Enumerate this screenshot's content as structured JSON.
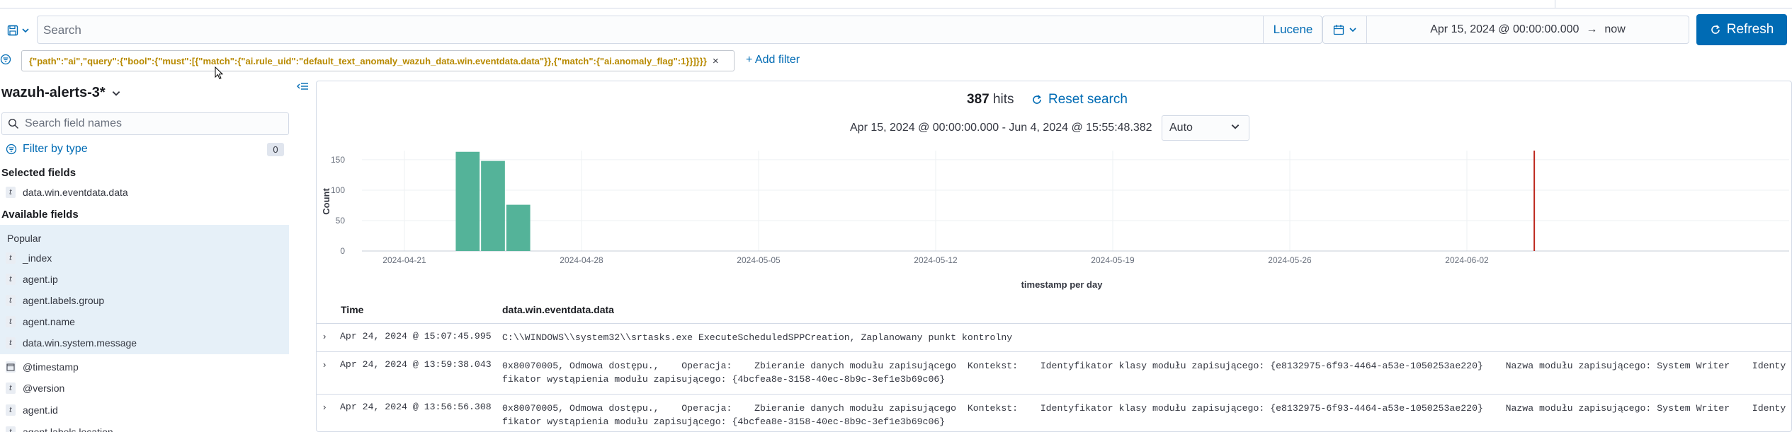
{
  "query_bar": {
    "search_placeholder": "Search",
    "language": "Lucene",
    "date_start": "Apr 15, 2024 @ 00:00:00.000",
    "date_arrow": "→",
    "date_end": "now",
    "refresh_label": "Refresh"
  },
  "filter_bar": {
    "filter_text": "{\"path\":\"ai\",\"query\":{\"bool\":{\"must\":[{\"match\":{\"ai.rule_uid\":\"default_text_anomaly_wazuh_data.win.eventdata.data\"}},{\"match\":{\"ai.anomaly_flag\":1}}]}}}",
    "add_filter": "+ Add filter"
  },
  "sidebar": {
    "index_pattern": "wazuh-alerts-3*",
    "field_search_placeholder": "Search field names",
    "filter_by_type": "Filter by type",
    "type_count": "0",
    "selected_title": "Selected fields",
    "selected_fields": [
      {
        "type": "t",
        "name": "data.win.eventdata.data"
      }
    ],
    "available_title": "Available fields",
    "popular_title": "Popular",
    "popular_fields": [
      {
        "type": "t",
        "name": "_index"
      },
      {
        "type": "t",
        "name": "agent.ip"
      },
      {
        "type": "t",
        "name": "agent.labels.group"
      },
      {
        "type": "t",
        "name": "agent.name"
      },
      {
        "type": "t",
        "name": "data.win.system.message"
      }
    ],
    "other_fields": [
      {
        "type": "date",
        "name": "@timestamp"
      },
      {
        "type": "t",
        "name": "@version"
      },
      {
        "type": "t",
        "name": "agent.id"
      },
      {
        "type": "t",
        "name": "agent.labels.location"
      }
    ]
  },
  "results": {
    "hits_count": "387",
    "hits_label": "hits",
    "reset_label": "Reset search",
    "range_text": "Apr 15, 2024 @ 00:00:00.000 - Jun 4, 2024 @ 15:55:48.382",
    "interval": "Auto"
  },
  "chart_data": {
    "type": "bar",
    "x_start": "2024-04-15",
    "x_end": "2024-06-04",
    "bars": [
      {
        "date": "2024-04-23",
        "count": 163
      },
      {
        "date": "2024-04-24",
        "count": 148
      },
      {
        "date": "2024-04-25",
        "count": 76
      }
    ],
    "ylim": [
      0,
      165
    ],
    "yticks": [
      0,
      50,
      100,
      150
    ],
    "xticks": [
      "2024-04-21",
      "2024-04-28",
      "2024-05-05",
      "2024-05-12",
      "2024-05-19",
      "2024-05-26",
      "2024-06-02"
    ],
    "ylabel": "Count",
    "xlabel": "timestamp per day",
    "bar_color": "#54b399",
    "now_marker_date": "2024-06-04",
    "now_marker_color": "#bd271e"
  },
  "table": {
    "col_time": "Time",
    "col_data": "data.win.eventdata.data",
    "rows": [
      {
        "time": "Apr 24, 2024 @ 15:07:45.995",
        "data": "C:\\\\WINDOWS\\\\system32\\\\srtasks.exe ExecuteScheduledSPPCreation, Zaplanowany punkt kontrolny"
      },
      {
        "time": "Apr 24, 2024 @ 13:59:38.043",
        "data": "0x80070005, Odmowa dostępu.,    Operacja:    Zbieranie danych modułu zapisującego  Kontekst:    Identyfikator klasy modułu zapisującego: {e8132975-6f93-4464-a53e-1050253ae220}    Nazwa modułu zapisującego: System Writer    Identyfikator wystąpienia modułu zapisującego: {4bcfea8e-3158-40ec-8b9c-3ef1e3b69c06}"
      },
      {
        "time": "Apr 24, 2024 @ 13:56:56.308",
        "data": "0x80070005, Odmowa dostępu.,    Operacja:    Zbieranie danych modułu zapisującego  Kontekst:    Identyfikator klasy modułu zapisującego: {e8132975-6f93-4464-a53e-1050253ae220}    Nazwa modułu zapisującego: System Writer    Identyfikator wystąpienia modułu zapisującego: {4bcfea8e-3158-40ec-8b9c-3ef1e3b69c06}"
      }
    ]
  }
}
